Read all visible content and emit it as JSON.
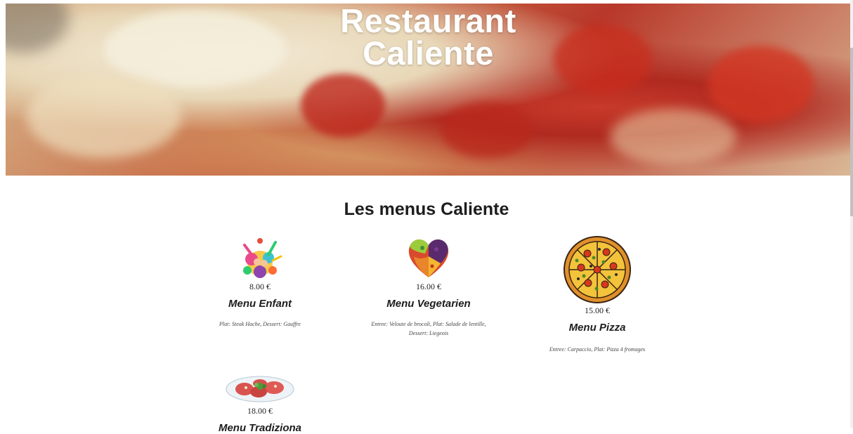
{
  "site": {
    "title_line1": "Restaurant",
    "title_line2": "Caliente"
  },
  "section": {
    "title": "Les menus Caliente"
  },
  "menus": [
    {
      "name": "Menu Enfant",
      "price": "8.00 €",
      "description": "Plat: Steak Hache, Dessert: Gauffre",
      "image": "paint-splash-kids-image"
    },
    {
      "name": "Menu Vegetarien",
      "price": "16.00 €",
      "description": "Entree: Veloute de brocoli, Plat: Salade de lentille, Dessert: Liegeois",
      "image": "vegetable-heart-image"
    },
    {
      "name": "Menu Pizza",
      "price": "15.00 €",
      "description": "Entree: Carpaccio, Plat: Pizza 4 fromages",
      "image": "pizza-image"
    },
    {
      "name": "Menu Tradiziona",
      "price": "18.00 €",
      "description": "",
      "image": "antipasto-plate-image"
    }
  ]
}
